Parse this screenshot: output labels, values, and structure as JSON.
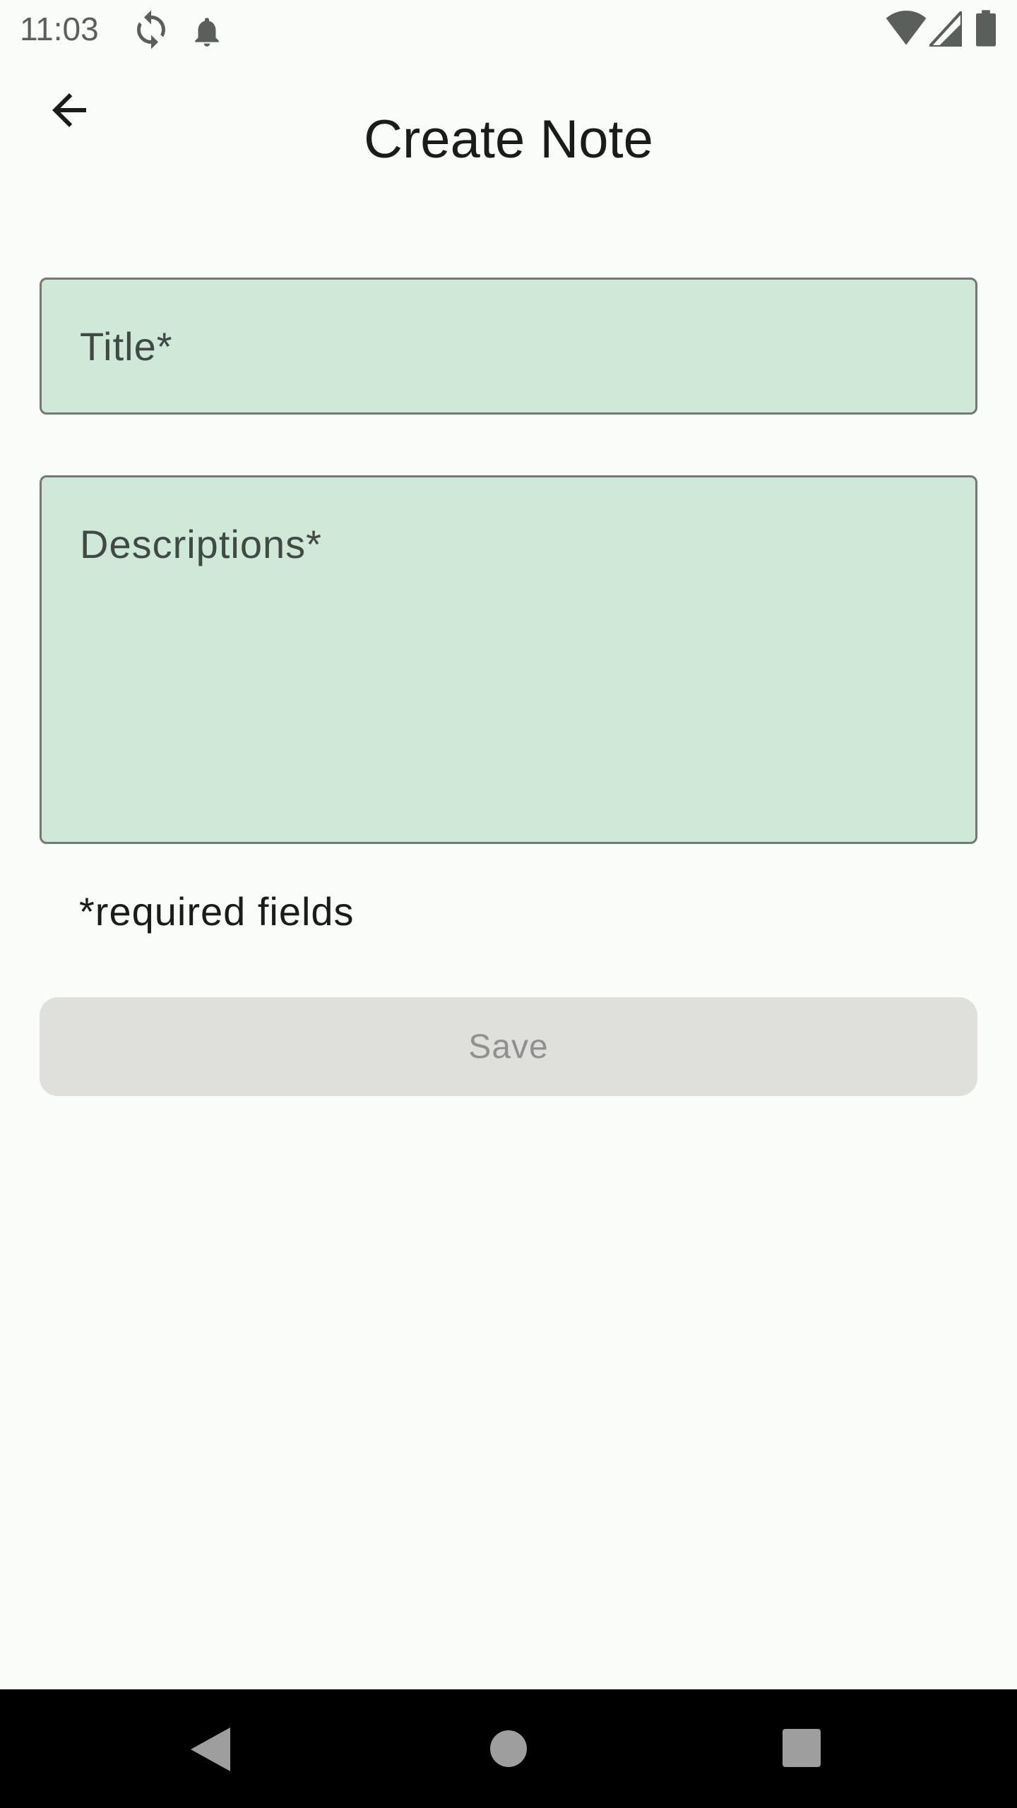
{
  "status_bar": {
    "time": "11:03",
    "icons": [
      "sync-icon",
      "notification-bell-icon",
      "wifi-icon",
      "cellular-signal-icon",
      "battery-icon"
    ]
  },
  "app_bar": {
    "title": "Create Note",
    "back_icon": "arrow-back-icon"
  },
  "form": {
    "title_placeholder": "Title*",
    "title_value": "",
    "description_placeholder": "Descriptions*",
    "description_value": "",
    "required_note": "*required fields",
    "save_label": "Save",
    "save_enabled": false
  },
  "nav_bar": {
    "buttons": [
      "back-triangle-icon",
      "home-circle-icon",
      "recents-square-icon"
    ]
  },
  "colors": {
    "background": "#f9fcf8",
    "field_fill": "#cfe8d8",
    "field_border": "#6f7a72",
    "button_disabled_bg": "#dfe0dc",
    "button_disabled_text": "#8e918d",
    "nav_bar": "#000000"
  }
}
